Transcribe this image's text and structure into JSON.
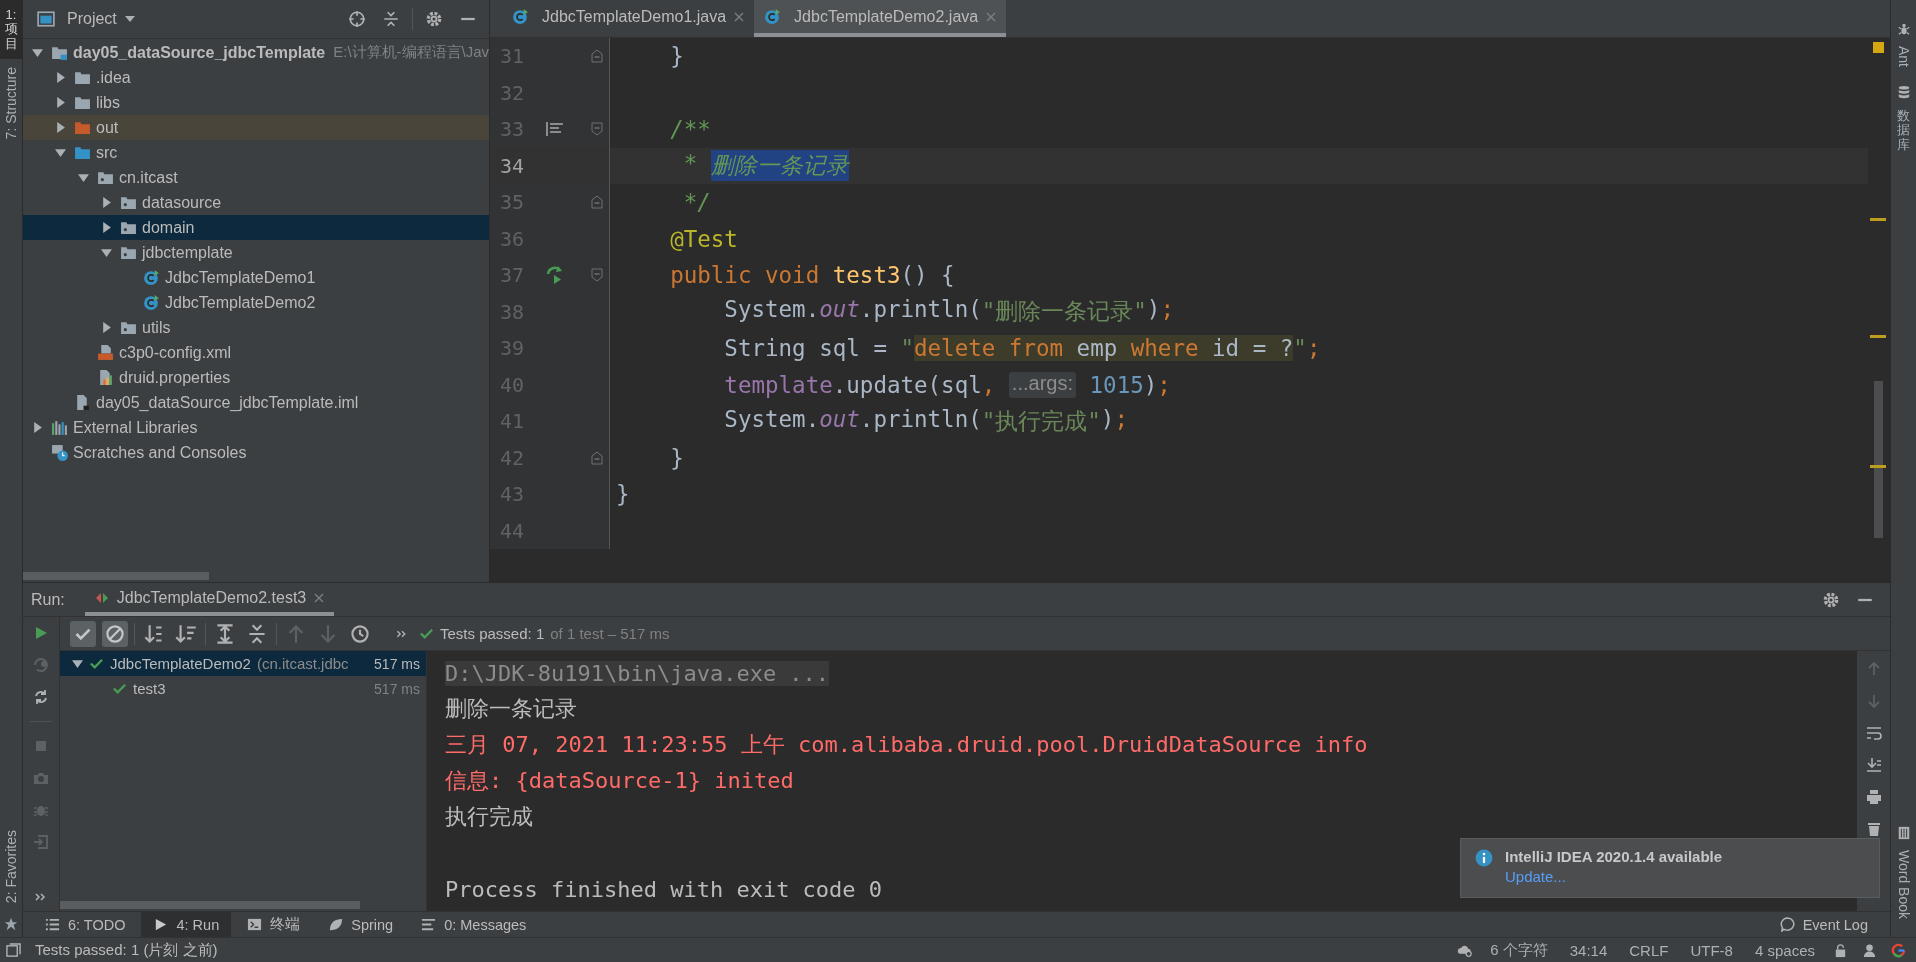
{
  "left_strip": {
    "top": [
      {
        "label": "1: 项目",
        "selected": true
      },
      {
        "label": "7: Structure",
        "selected": false
      }
    ],
    "bottom": [
      {
        "label": "2: Favorites",
        "selected": false
      }
    ]
  },
  "project_panel": {
    "title": "Project",
    "tree": [
      {
        "name": "day05_dataSource_jdbcTemplate",
        "hint": "E:\\计算机-编程语言\\Jav",
        "kind": "module",
        "expanded": true,
        "selected": false,
        "children": [
          {
            "name": ".idea",
            "kind": "folder",
            "expanded": false,
            "selected": false
          },
          {
            "name": "libs",
            "kind": "folder",
            "expanded": false,
            "selected": false
          },
          {
            "name": "out",
            "kind": "excluded",
            "expanded": false,
            "selected": false
          },
          {
            "name": "src",
            "kind": "source",
            "expanded": true,
            "selected": false,
            "children": [
              {
                "name": "cn.itcast",
                "kind": "package",
                "expanded": true,
                "selected": false,
                "children": [
                  {
                    "name": "datasource",
                    "kind": "package",
                    "expanded": false,
                    "selected": false
                  },
                  {
                    "name": "domain",
                    "kind": "package",
                    "expanded": false,
                    "selected": true
                  },
                  {
                    "name": "jdbctemplate",
                    "kind": "package",
                    "expanded": true,
                    "selected": false,
                    "children": [
                      {
                        "name": "JdbcTemplateDemo1",
                        "kind": "class",
                        "selected": false
                      },
                      {
                        "name": "JdbcTemplateDemo2",
                        "kind": "class",
                        "selected": false
                      }
                    ]
                  },
                  {
                    "name": "utils",
                    "kind": "package",
                    "expanded": false,
                    "selected": false
                  }
                ]
              },
              {
                "name": "c3p0-config.xml",
                "kind": "xml",
                "selected": false
              },
              {
                "name": "druid.properties",
                "kind": "properties",
                "selected": false
              }
            ]
          },
          {
            "name": "day05_dataSource_jdbcTemplate.iml",
            "kind": "iml",
            "selected": false
          }
        ]
      },
      {
        "name": "External Libraries",
        "kind": "libraries",
        "expanded": false,
        "selected": false
      },
      {
        "name": "Scratches and Consoles",
        "kind": "scratches",
        "selected": false
      }
    ]
  },
  "editor": {
    "tabs": [
      {
        "label": "JdbcTemplateDemo1.java",
        "selected": false
      },
      {
        "label": "JdbcTemplateDemo2.java",
        "selected": true
      }
    ],
    "lines": [
      {
        "number": "31",
        "current": false,
        "fold": {
          "kind": "close"
        },
        "tokens": [
          {
            "kind": "plain",
            "text": "    }"
          }
        ]
      },
      {
        "number": "32",
        "current": false
      },
      {
        "number": "33",
        "current": false,
        "fold": {
          "kind": "open"
        },
        "gutter_icon": {
          "kind": "doc"
        },
        "tokens": [
          {
            "kind": "doc",
            "text": "    /**"
          }
        ]
      },
      {
        "number": "34",
        "current": true,
        "tokens": [
          {
            "kind": "doc",
            "text": "     * "
          },
          {
            "kind": "doc-selected",
            "text": "删除一条记录"
          }
        ]
      },
      {
        "number": "35",
        "current": false,
        "fold": {
          "kind": "close"
        },
        "tokens": [
          {
            "kind": "doc",
            "text": "     */"
          }
        ]
      },
      {
        "number": "36",
        "current": false,
        "tokens": [
          {
            "kind": "annotation",
            "text": "    @Test"
          }
        ]
      },
      {
        "number": "37",
        "current": false,
        "fold": {
          "kind": "open"
        },
        "gutter_icon": {
          "kind": "run"
        },
        "tokens": [
          {
            "kind": "keyword",
            "text": "    public void "
          },
          {
            "kind": "method",
            "text": "test3"
          },
          {
            "kind": "plain",
            "text": "() {"
          }
        ]
      },
      {
        "number": "38",
        "current": false,
        "tokens": [
          {
            "kind": "plain",
            "text": "        System."
          },
          {
            "kind": "field",
            "text": "out"
          },
          {
            "kind": "plain",
            "text": ".println("
          },
          {
            "kind": "string",
            "text": "\"删除一条记录\""
          },
          {
            "kind": "plain",
            "text": ")"
          },
          {
            "kind": "keyword",
            "text": ";"
          }
        ]
      },
      {
        "number": "39",
        "current": false,
        "tokens": [
          {
            "kind": "plain",
            "text": "        String sql = "
          },
          {
            "kind": "string",
            "text": "\""
          },
          {
            "kind": "sql-keyword",
            "text": "delete "
          },
          {
            "kind": "sql-keyword",
            "text": "from"
          },
          {
            "kind": "sql",
            "text": " emp "
          },
          {
            "kind": "sql-keyword",
            "text": "where"
          },
          {
            "kind": "sql",
            "text": " id = ?"
          },
          {
            "kind": "string",
            "text": "\""
          },
          {
            "kind": "keyword",
            "text": ";"
          }
        ]
      },
      {
        "number": "40",
        "current": false,
        "tokens": [
          {
            "kind": "member",
            "text": "        template"
          },
          {
            "kind": "plain",
            "text": ".update(sql"
          },
          {
            "kind": "keyword",
            "text": ", "
          },
          {
            "kind": "hint",
            "text": "...args:"
          },
          {
            "kind": "number",
            "text": " 1015"
          },
          {
            "kind": "plain",
            "text": ")"
          },
          {
            "kind": "keyword",
            "text": ";"
          }
        ]
      },
      {
        "number": "41",
        "current": false,
        "tokens": [
          {
            "kind": "plain",
            "text": "        System."
          },
          {
            "kind": "field",
            "text": "out"
          },
          {
            "kind": "plain",
            "text": ".println("
          },
          {
            "kind": "string",
            "text": "\"执行完成\""
          },
          {
            "kind": "plain",
            "text": ")"
          },
          {
            "kind": "keyword",
            "text": ";"
          }
        ]
      },
      {
        "number": "42",
        "current": false,
        "fold": {
          "kind": "close"
        },
        "tokens": [
          {
            "kind": "plain",
            "text": "    }"
          }
        ]
      },
      {
        "number": "43",
        "current": false,
        "tokens": [
          {
            "kind": "plain",
            "text": "}"
          }
        ]
      },
      {
        "number": "44",
        "current": false
      }
    ]
  },
  "run_panel": {
    "label": "Run:",
    "tab": "JdbcTemplateDemo2.test3",
    "passed": "Tests passed: 1",
    "passed_detail": "of 1 test – 517 ms",
    "tests": [
      {
        "name": "JdbcTemplateDemo2",
        "hint": "(cn.itcast.jdbc",
        "time": "517 ms",
        "expanded": true,
        "selected": true,
        "children": [
          {
            "name": "test3",
            "time": "517 ms",
            "selected": false
          }
        ]
      }
    ],
    "console": [
      {
        "kind": "command",
        "text": "D:\\JDK-8u191\\bin\\java.exe ..."
      },
      {
        "kind": "output",
        "text": "删除一条记录"
      },
      {
        "kind": "error",
        "text": "三月 07, 2021 11:23:55 上午 com.alibaba.druid.pool.DruidDataSource info"
      },
      {
        "kind": "error",
        "text": "信息: {dataSource-1} inited"
      },
      {
        "kind": "output",
        "text": "执行完成"
      },
      {
        "kind": "blank"
      },
      {
        "kind": "output",
        "text": "Process finished with exit code 0"
      }
    ]
  },
  "notification": {
    "title": "IntelliJ IDEA 2020.1.4 available",
    "link": "Update..."
  },
  "tool_bar": [
    {
      "label": "6: TODO",
      "selected": false
    },
    {
      "label": "4: Run",
      "selected": true
    },
    {
      "label": "终端",
      "selected": false
    },
    {
      "label": "Spring",
      "selected": false
    },
    {
      "label": "0: Messages",
      "selected": false
    }
  ],
  "event_log": "Event Log",
  "right_strip": {
    "top": [
      "Ant",
      "数据库"
    ],
    "bottom": [
      "Word Book"
    ]
  },
  "status_bar": {
    "message": "Tests passed: 1 (片刻 之前)",
    "items": [
      "6 个字符",
      "34:14",
      "CRLF",
      "UTF-8",
      "4 spaces"
    ]
  }
}
